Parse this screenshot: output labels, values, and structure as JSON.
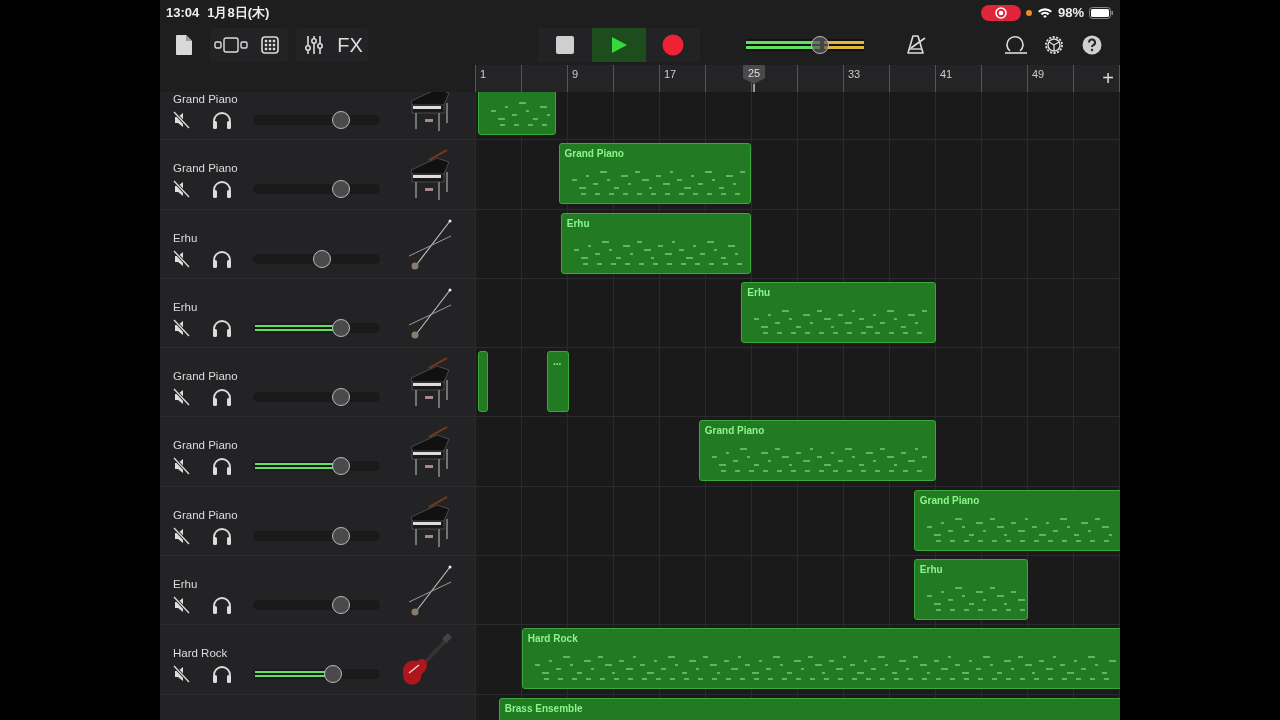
{
  "status_bar": {
    "time": "13:04",
    "date": "1月8日(木)",
    "recording": true,
    "battery": "98%"
  },
  "toolbar": {
    "fx_label": "FX",
    "transport": [
      {
        "kind": "stop",
        "selected": false
      },
      {
        "kind": "play",
        "selected": true
      },
      {
        "kind": "record",
        "selected": false
      }
    ],
    "master_volume": {
      "level": 0.63
    }
  },
  "ruler": {
    "labels": [
      "1",
      "9",
      "17",
      "33",
      "41",
      "49"
    ],
    "playhead": "25",
    "add_button": "+"
  },
  "tracks": [
    {
      "name": "Grand Piano",
      "kind": "piano",
      "playing": false,
      "volume": {
        "level": 0.69
      },
      "regions": [
        {
          "kind": "midi"
        }
      ]
    },
    {
      "name": "Grand Piano",
      "kind": "piano",
      "playing": false,
      "volume": {
        "level": 0.69
      },
      "regions": [
        {
          "kind": "midi",
          "label": "Grand Piano"
        }
      ]
    },
    {
      "name": "Erhu",
      "kind": "erhu",
      "playing": false,
      "volume": {
        "level": 0.54
      },
      "regions": [
        {
          "kind": "midi",
          "label": "Erhu"
        }
      ]
    },
    {
      "name": "Erhu",
      "kind": "erhu",
      "playing": true,
      "volume": {
        "level": 0.69
      },
      "regions": [
        {
          "kind": "midi",
          "label": "Erhu"
        }
      ]
    },
    {
      "name": "Grand Piano",
      "kind": "piano",
      "playing": false,
      "volume": {
        "level": 0.69
      },
      "regions": [
        {
          "kind": "midi"
        },
        {
          "kind": "midi",
          "label": "..."
        }
      ]
    },
    {
      "name": "Grand Piano",
      "kind": "piano",
      "playing": true,
      "volume": {
        "level": 0.69
      },
      "regions": [
        {
          "kind": "midi",
          "label": "Grand Piano"
        }
      ]
    },
    {
      "name": "Grand Piano",
      "kind": "piano",
      "playing": false,
      "volume": {
        "level": 0.69
      },
      "regions": [
        {
          "kind": "midi",
          "label": "Grand Piano"
        }
      ]
    },
    {
      "name": "Erhu",
      "kind": "erhu",
      "playing": false,
      "volume": {
        "level": 0.69
      },
      "regions": [
        {
          "kind": "midi",
          "label": "Erhu"
        }
      ]
    },
    {
      "name": "Hard Rock",
      "kind": "guitar",
      "playing": true,
      "volume": {
        "level": 0.63
      },
      "regions": [
        {
          "kind": "midi",
          "label": "Hard Rock"
        }
      ]
    },
    {
      "kind": "brass",
      "regions": [
        {
          "kind": "midi",
          "label": "Brass Ensemble"
        }
      ]
    }
  ]
}
